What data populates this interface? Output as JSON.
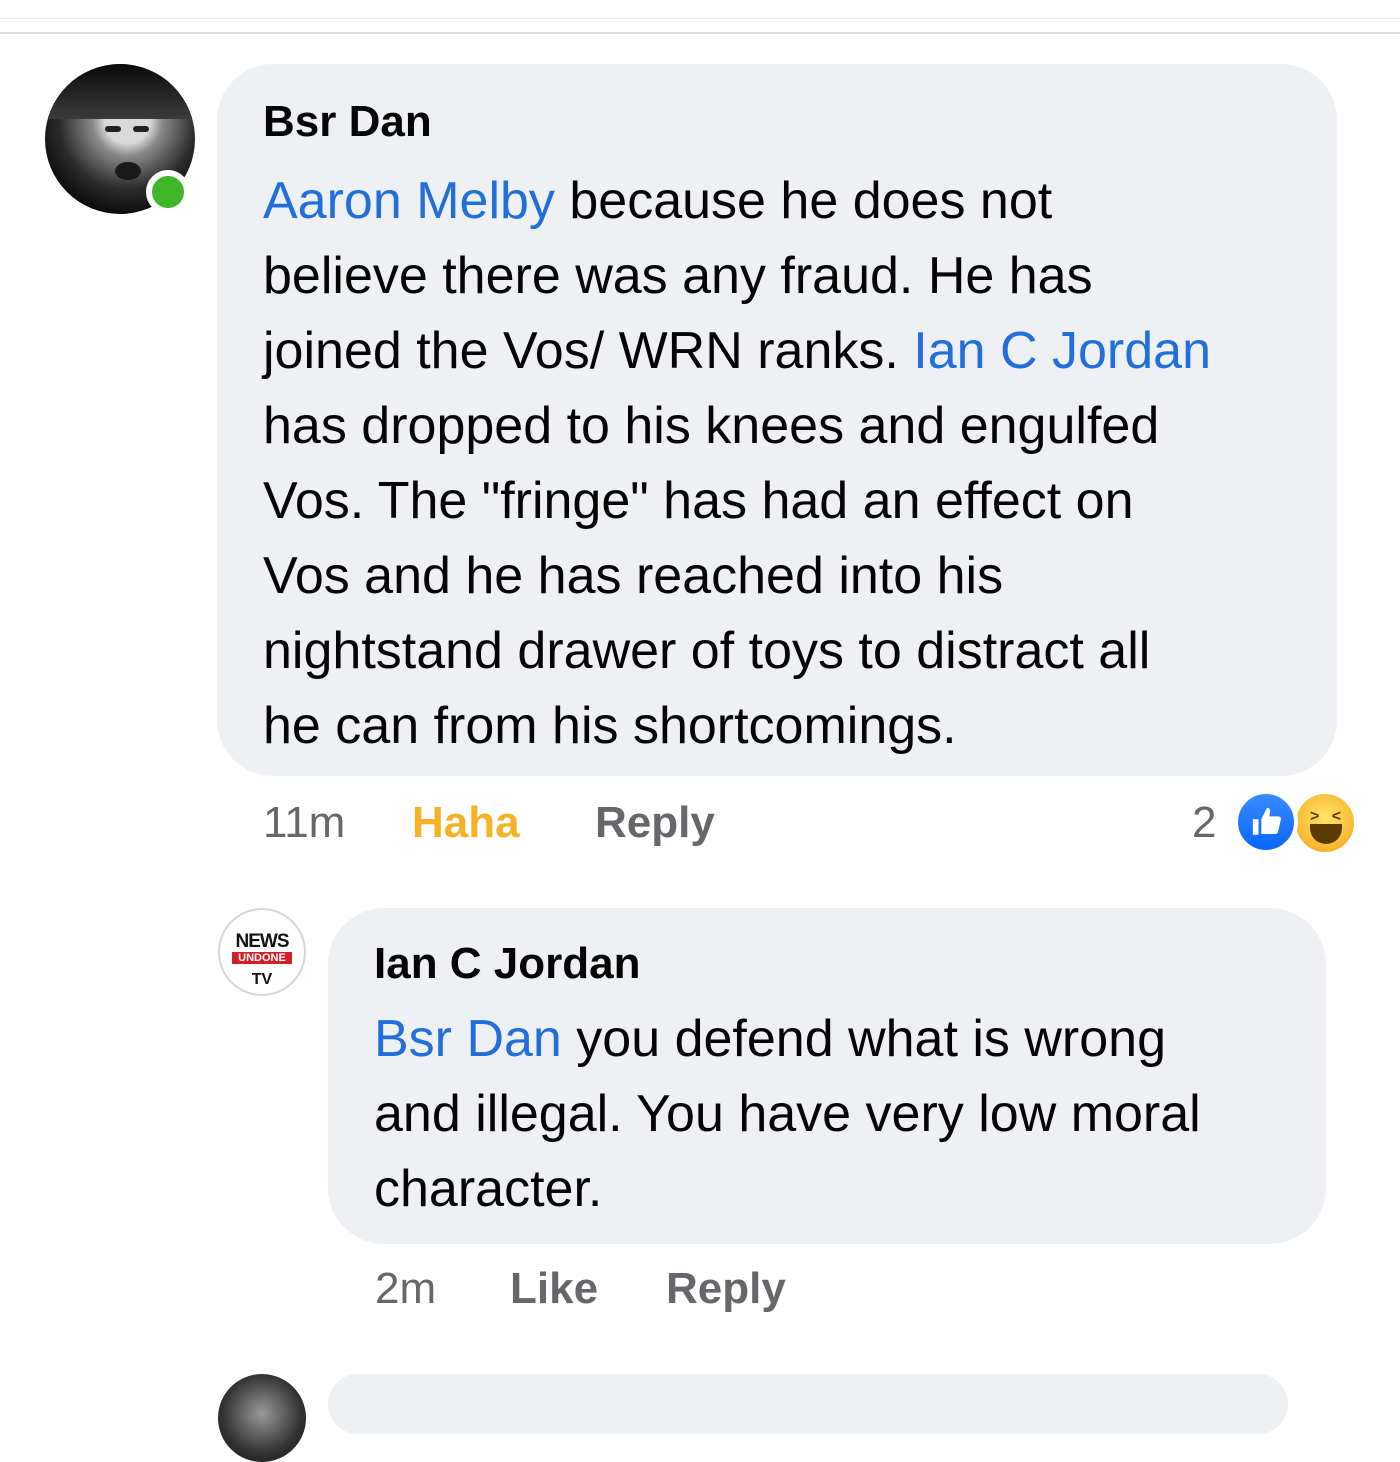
{
  "comments": [
    {
      "author": "Bsr Dan",
      "online": true,
      "body_lines": [
        {
          "mention": "Aaron Melby",
          "text": " because he does not"
        },
        {
          "text": "believe there was any fraud. He has"
        },
        {
          "text": "joined the Vos/ WRN ranks. ",
          "mention_after": "Ian C Jordan"
        },
        {
          "text": "has dropped to his knees and engulfed"
        },
        {
          "text": "Vos. The \"fringe\" has had an effect on"
        },
        {
          "text": "Vos and he has reached into his"
        },
        {
          "text": "nightstand drawer of toys to distract all"
        },
        {
          "text": "he can from his shortcomings."
        }
      ],
      "time": "11m",
      "reaction_label": "Haha",
      "reply_label": "Reply",
      "reaction_count": "2",
      "reaction_icons": [
        "like-icon",
        "haha-icon"
      ]
    },
    {
      "author": "Ian C Jordan",
      "avatar_text": {
        "top": "NEWS",
        "middle": "UNDONE",
        "bottom": "TV"
      },
      "body_lines": [
        {
          "mention": "Bsr Dan",
          "text": " you defend what is wrong"
        },
        {
          "text": "and illegal. You have very low moral"
        },
        {
          "text": "character."
        }
      ],
      "time": "2m",
      "like_label": "Like",
      "reply_label": "Reply"
    }
  ],
  "colors": {
    "mention": "#216fdb",
    "haha_active": "#f7b125",
    "bubble": "#eff0f4",
    "meta": "#65676b",
    "online": "#42b72a"
  }
}
